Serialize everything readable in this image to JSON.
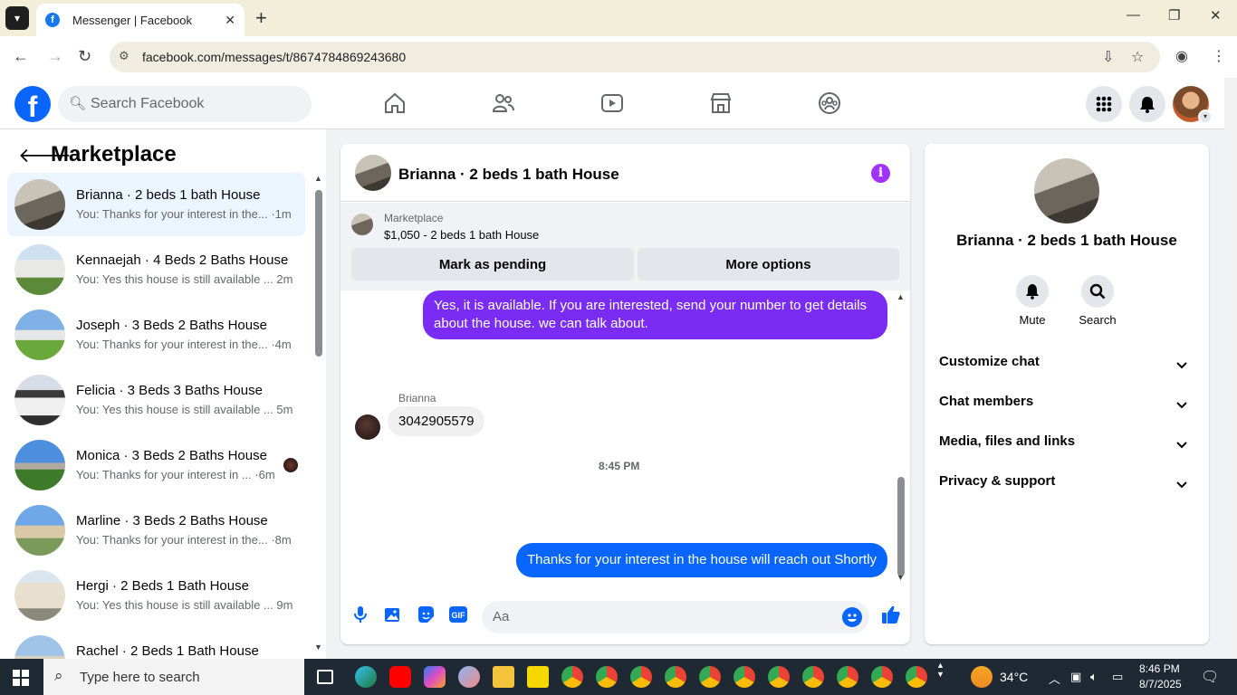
{
  "browser": {
    "tab_title": "Messenger | Facebook",
    "url": "facebook.com/messages/t/8674784869243680"
  },
  "fb": {
    "search_placeholder": "Search Facebook"
  },
  "sidebar": {
    "title": "Marketplace",
    "conversations": [
      {
        "name": "Brianna · 2 beds 1 bath House",
        "preview": "You: Thanks for your interest in the... ·1m",
        "active": true
      },
      {
        "name": "Kennaejah · 4 Beds 2 Baths House",
        "preview": "You: Yes this house is still available ... 2m"
      },
      {
        "name": "Joseph · 3 Beds 2 Baths House",
        "preview": "You: Thanks for your interest in the... ·4m"
      },
      {
        "name": "Felicia · 3 Beds 3 Baths House",
        "preview": "You: Yes this house is still available ... 5m"
      },
      {
        "name": "Monica · 3 Beds 2 Baths House",
        "preview": "You: Thanks for your interest in ... ·6m"
      },
      {
        "name": "Marline · 3 Beds 2 Baths House",
        "preview": "You: Thanks for your interest in the... ·8m"
      },
      {
        "name": "Hergi · 2 Beds 1 Bath House",
        "preview": "You: Yes this house is still available ... 9m"
      },
      {
        "name": "Rachel · 2 Beds 1 Bath House",
        "preview": ""
      }
    ]
  },
  "chat": {
    "title": "Brianna · 2 beds 1 bath House",
    "listing_label": "Marketplace",
    "listing_price": "$1,050 - 2 beds 1 bath House",
    "mark_pending": "Mark as pending",
    "more_options": "More options",
    "messages": {
      "out1": "Yes, it is available. If you are interested, send your number to get details about the house. we can talk about.",
      "sender": "Brianna",
      "in1": "3042905579",
      "timestamp": "8:45 PM",
      "out2": "Thanks for your interest in the house will reach out Shortly"
    },
    "composer_placeholder": "Aa"
  },
  "details": {
    "name": "Brianna · 2 beds 1 bath House",
    "mute": "Mute",
    "search": "Search",
    "sections": [
      "Customize chat",
      "Chat members",
      "Media, files and links",
      "Privacy & support"
    ]
  },
  "taskbar": {
    "search_placeholder": "Type here to search",
    "weather": "34°C",
    "time": "8:46 PM",
    "date": "8/7/2025"
  },
  "colors": {
    "fb_blue": "#0866ff",
    "purple_bubble": "#7a2cf5",
    "info_purple": "#a033ff"
  }
}
